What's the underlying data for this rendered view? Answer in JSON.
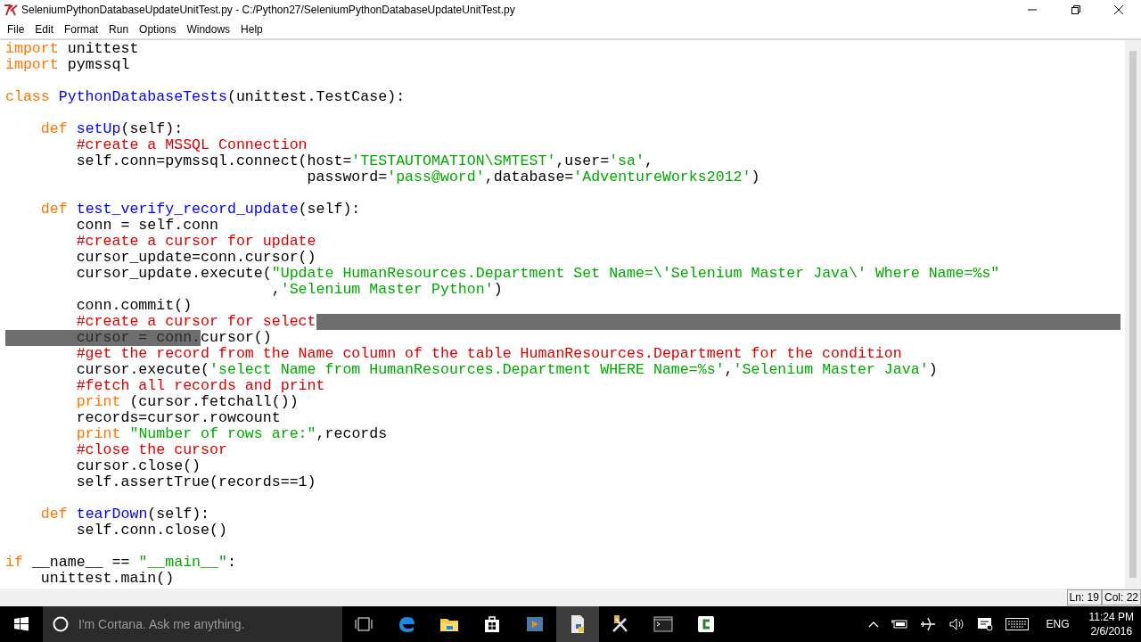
{
  "window": {
    "title": "SeleniumPythonDatabaseUpdateUnitTest.py - C:/Python27/SeleniumPythonDatabaseUpdateUnitTest.py"
  },
  "menu": [
    "File",
    "Edit",
    "Format",
    "Run",
    "Options",
    "Windows",
    "Help"
  ],
  "code": [
    {
      "kind": "code",
      "selected_to_end": false,
      "tokens": [
        {
          "text": "import ",
          "kind": "keyword"
        },
        {
          "text": "unittest",
          "kind": "plain"
        }
      ]
    },
    {
      "kind": "code",
      "selected_to_end": false,
      "tokens": [
        {
          "text": "import ",
          "kind": "keyword"
        },
        {
          "text": "pymssql",
          "kind": "plain"
        }
      ]
    },
    {
      "kind": "blank"
    },
    {
      "kind": "code",
      "selected_to_end": false,
      "tokens": [
        {
          "text": "class ",
          "kind": "keyword"
        },
        {
          "text": "PythonDatabaseTests",
          "kind": "name"
        },
        {
          "text": "(unittest.TestCase):",
          "kind": "plain"
        }
      ]
    },
    {
      "kind": "blank"
    },
    {
      "kind": "code",
      "selected_to_end": false,
      "tokens": [
        {
          "text": "    def ",
          "kind": "keyword"
        },
        {
          "text": "setUp",
          "kind": "name"
        },
        {
          "text": "(self):",
          "kind": "plain"
        }
      ]
    },
    {
      "kind": "code",
      "selected_to_end": false,
      "tokens": [
        {
          "text": "        #create a MSSQL Connection",
          "kind": "comment"
        }
      ]
    },
    {
      "kind": "code",
      "selected_to_end": false,
      "tokens": [
        {
          "text": "        self.conn=pymssql.connect(host=",
          "kind": "plain"
        },
        {
          "text": "'TESTAUTOMATION\\SMTEST'",
          "kind": "string"
        },
        {
          "text": ",user=",
          "kind": "plain"
        },
        {
          "text": "'sa'",
          "kind": "string"
        },
        {
          "text": ",",
          "kind": "plain"
        }
      ]
    },
    {
      "kind": "code",
      "selected_to_end": false,
      "tokens": [
        {
          "text": "                                  password=",
          "kind": "plain"
        },
        {
          "text": "'pass@word'",
          "kind": "string"
        },
        {
          "text": ",database=",
          "kind": "plain"
        },
        {
          "text": "'AdventureWorks2012'",
          "kind": "string"
        },
        {
          "text": ")",
          "kind": "plain"
        }
      ]
    },
    {
      "kind": "blank"
    },
    {
      "kind": "code",
      "selected_to_end": false,
      "tokens": [
        {
          "text": "    def ",
          "kind": "keyword"
        },
        {
          "text": "test_verify_record_update",
          "kind": "name"
        },
        {
          "text": "(self):",
          "kind": "plain"
        }
      ]
    },
    {
      "kind": "code",
      "selected_to_end": false,
      "tokens": [
        {
          "text": "        conn = self.conn",
          "kind": "plain"
        }
      ]
    },
    {
      "kind": "code",
      "selected_to_end": false,
      "tokens": [
        {
          "text": "        #create a cursor for update",
          "kind": "comment"
        }
      ]
    },
    {
      "kind": "code",
      "selected_to_end": false,
      "tokens": [
        {
          "text": "        cursor_update=conn.cursor()",
          "kind": "plain"
        }
      ]
    },
    {
      "kind": "code",
      "selected_to_end": false,
      "tokens": [
        {
          "text": "        cursor_update.execute(",
          "kind": "plain"
        },
        {
          "text": "\"Update HumanResources.Department Set Name=\\'Selenium Master Java\\' Where Name=%s\"",
          "kind": "string"
        }
      ]
    },
    {
      "kind": "code",
      "selected_to_end": false,
      "tokens": [
        {
          "text": "                              ,",
          "kind": "plain"
        },
        {
          "text": "'Selenium Master Python'",
          "kind": "string"
        },
        {
          "text": ")",
          "kind": "plain"
        }
      ]
    },
    {
      "kind": "code",
      "selected_to_end": false,
      "tokens": [
        {
          "text": "        conn.commit()",
          "kind": "plain"
        }
      ]
    },
    {
      "kind": "code",
      "selected_to_end": true,
      "tokens": [
        {
          "text": "        #create a cursor for select",
          "kind": "comment"
        }
      ]
    },
    {
      "kind": "code",
      "selected_to_end": false,
      "tokens": [
        {
          "text": "        cursor = conn.",
          "kind": "selected"
        },
        {
          "text": "cursor()",
          "kind": "plain"
        }
      ]
    },
    {
      "kind": "code",
      "selected_to_end": false,
      "tokens": [
        {
          "text": "        #get the record from the Name column of the table HumanResources.Department for the condition",
          "kind": "comment"
        }
      ]
    },
    {
      "kind": "code",
      "selected_to_end": false,
      "tokens": [
        {
          "text": "        cursor.execute(",
          "kind": "plain"
        },
        {
          "text": "'select Name from HumanResources.Department WHERE Name=%s'",
          "kind": "string"
        },
        {
          "text": ",",
          "kind": "plain"
        },
        {
          "text": "'Selenium Master Java'",
          "kind": "string"
        },
        {
          "text": ")",
          "kind": "plain"
        }
      ]
    },
    {
      "kind": "code",
      "selected_to_end": false,
      "tokens": [
        {
          "text": "        #fetch all records and print",
          "kind": "comment"
        }
      ]
    },
    {
      "kind": "code",
      "selected_to_end": false,
      "tokens": [
        {
          "text": "        print",
          "kind": "keyword"
        },
        {
          "text": " (cursor.fetchall())",
          "kind": "plain"
        }
      ]
    },
    {
      "kind": "code",
      "selected_to_end": false,
      "tokens": [
        {
          "text": "        records=cursor.rowcount",
          "kind": "plain"
        }
      ]
    },
    {
      "kind": "code",
      "selected_to_end": false,
      "tokens": [
        {
          "text": "        print ",
          "kind": "keyword"
        },
        {
          "text": "\"Number of rows are:\"",
          "kind": "string"
        },
        {
          "text": ",records",
          "kind": "plain"
        }
      ]
    },
    {
      "kind": "code",
      "selected_to_end": false,
      "tokens": [
        {
          "text": "        #close the cursor",
          "kind": "comment"
        }
      ]
    },
    {
      "kind": "code",
      "selected_to_end": false,
      "tokens": [
        {
          "text": "        cursor.close()",
          "kind": "plain"
        }
      ]
    },
    {
      "kind": "code",
      "selected_to_end": false,
      "tokens": [
        {
          "text": "        self.assertTrue(records==1)",
          "kind": "plain"
        }
      ]
    },
    {
      "kind": "blank"
    },
    {
      "kind": "code",
      "selected_to_end": false,
      "tokens": [
        {
          "text": "    def ",
          "kind": "keyword"
        },
        {
          "text": "tearDown",
          "kind": "name"
        },
        {
          "text": "(self):",
          "kind": "plain"
        }
      ]
    },
    {
      "kind": "code",
      "selected_to_end": false,
      "tokens": [
        {
          "text": "        self.conn.close()",
          "kind": "plain"
        }
      ]
    },
    {
      "kind": "blank"
    },
    {
      "kind": "code",
      "selected_to_end": false,
      "tokens": [
        {
          "text": "if ",
          "kind": "keyword"
        },
        {
          "text": "__name__ == ",
          "kind": "plain"
        },
        {
          "text": "\"__main__\"",
          "kind": "string"
        },
        {
          "text": ":",
          "kind": "plain"
        }
      ]
    },
    {
      "kind": "code",
      "selected_to_end": false,
      "tokens": [
        {
          "text": "    unittest.main()",
          "kind": "plain"
        }
      ]
    }
  ],
  "status_bar": {
    "line": "Ln: 19",
    "column": "Col: 22"
  },
  "taskbar": {
    "search": {
      "placeholder": "I'm Cortana. Ask me anything."
    },
    "apps": [
      {
        "kind": "taskview",
        "selected": false
      },
      {
        "kind": "edge",
        "selected": false
      },
      {
        "kind": "folder",
        "selected": false
      },
      {
        "kind": "store",
        "selected": false
      },
      {
        "kind": "media",
        "selected": false
      },
      {
        "kind": "python",
        "selected": true
      },
      {
        "kind": "tools",
        "selected": false
      },
      {
        "kind": "console",
        "selected": false
      },
      {
        "kind": "recorder",
        "selected": false
      }
    ],
    "language": "ENG",
    "time": "11:24 PM",
    "date": "2/6/2016"
  }
}
